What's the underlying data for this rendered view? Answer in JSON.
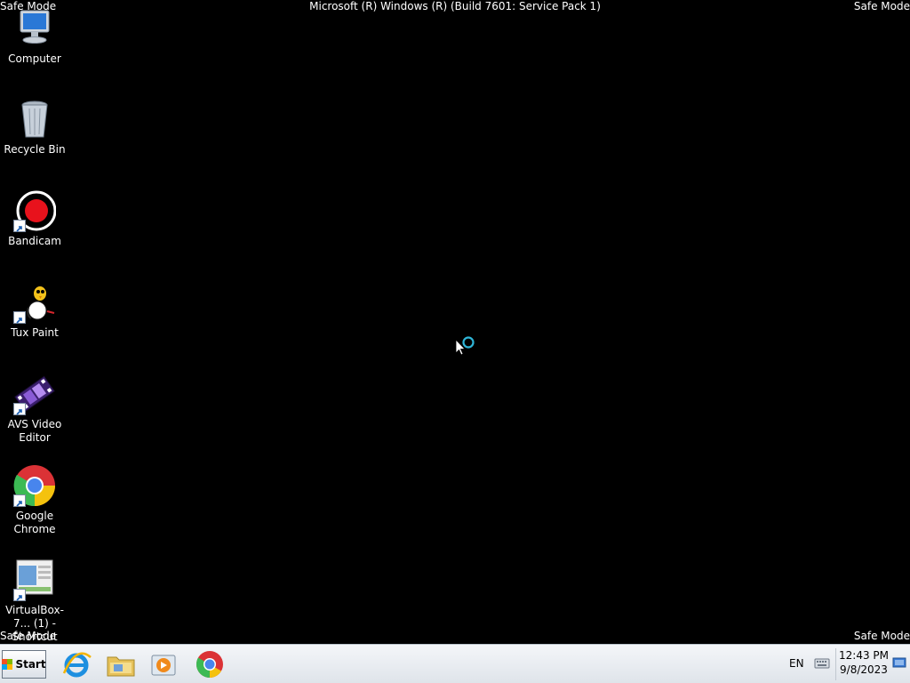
{
  "overlay": {
    "safe_mode_label": "Safe Mode",
    "build_text": "Microsoft (R) Windows (R) (Build 7601: Service Pack 1)"
  },
  "desktop_icons": [
    {
      "label": "Computer",
      "icon": "computer-icon"
    },
    {
      "label": "Recycle Bin",
      "icon": "recycle-bin-icon"
    },
    {
      "label": "Bandicam",
      "icon": "bandicam-icon"
    },
    {
      "label": "Tux Paint",
      "icon": "tux-paint-icon"
    },
    {
      "label": "AVS Video Editor",
      "icon": "avs-video-editor-icon"
    },
    {
      "label": "Google Chrome",
      "icon": "chrome-icon"
    },
    {
      "label": "VirtualBox-7... (1) - Shortcut",
      "icon": "virtualbox-shortcut-icon"
    }
  ],
  "taskbar": {
    "start_label": "Start",
    "pinned": [
      "internet-explorer-icon",
      "file-explorer-icon",
      "media-player-icon",
      "chrome-icon"
    ],
    "tray": {
      "language": "EN",
      "time": "12:43 PM",
      "date": "9/8/2023"
    }
  },
  "colors": {
    "desktop_background": "#000000",
    "taskbar_background": "#e8ecf1"
  }
}
